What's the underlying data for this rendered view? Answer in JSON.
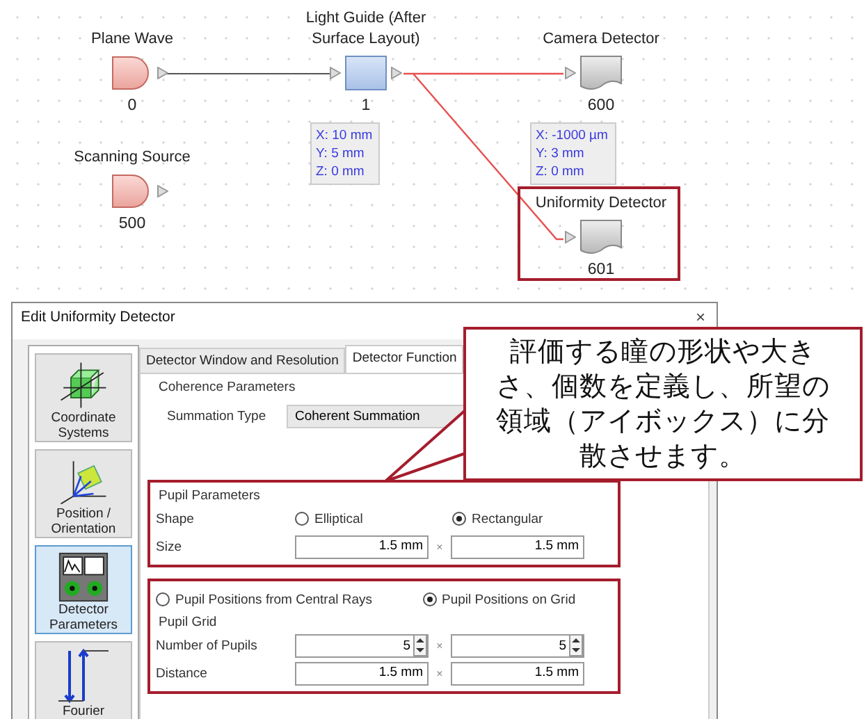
{
  "canvas": {
    "nodes": [
      {
        "kind": "source",
        "label": "Plane Wave",
        "number": "0",
        "highlighted": false
      },
      {
        "kind": "source",
        "label": "Scanning Source",
        "number": "500",
        "highlighted": false
      },
      {
        "kind": "component",
        "label": "Light Guide (After Surface Layout)",
        "number": "1",
        "highlighted": false
      },
      {
        "kind": "detector",
        "label": "Camera Detector",
        "number": "600",
        "highlighted": false
      },
      {
        "kind": "detector",
        "label": "Uniformity Detector",
        "number": "601",
        "highlighted": true
      }
    ],
    "info_boxes": [
      {
        "lines": [
          "X: 10 mm",
          "Y: 5 mm",
          "Z: 0 mm"
        ]
      },
      {
        "lines": [
          "X: -1000 µm",
          "Y: 3 mm",
          "Z: 0 mm"
        ]
      }
    ]
  },
  "dialog": {
    "title": "Edit Uniformity Detector",
    "close": "×",
    "sidebar": [
      {
        "label": "Coordinate\nSystems",
        "selected": false
      },
      {
        "label": "Position /\nOrientation",
        "selected": false
      },
      {
        "label": "Detector\nParameters",
        "selected": true
      },
      {
        "label": "Fourier",
        "selected": false
      }
    ],
    "tabs": [
      {
        "label": "Detector Window and Resolution",
        "selected": false
      },
      {
        "label": "Detector Function",
        "selected": true
      }
    ],
    "coherence": {
      "title": "Coherence Parameters",
      "label": "Summation Type",
      "value": "Coherent Summation"
    },
    "pupil_parameters": {
      "title": "Pupil Parameters",
      "shape_label": "Shape",
      "shape_options": [
        {
          "label": "Elliptical",
          "selected": false
        },
        {
          "label": "Rectangular",
          "selected": true
        }
      ],
      "size_label": "Size",
      "size_values": [
        "1.5 mm",
        "1.5 mm"
      ],
      "separator": "×"
    },
    "pupil_positions": {
      "options": [
        {
          "label": "Pupil Positions from Central Rays",
          "selected": false
        },
        {
          "label": "Pupil Positions on Grid",
          "selected": true
        }
      ],
      "grid_title": "Pupil Grid",
      "rows": [
        {
          "kind": "spinner",
          "label": "Number of Pupils",
          "values": [
            "5",
            "5"
          ]
        },
        {
          "kind": "length",
          "label": "Distance",
          "values": [
            "1.5 mm",
            "1.5 mm"
          ]
        }
      ],
      "separator": "×"
    }
  },
  "callout": {
    "text": "評価する瞳の形状や大きさ、個数を定義し、所望の領域（アイボックス）に分散させます。"
  }
}
